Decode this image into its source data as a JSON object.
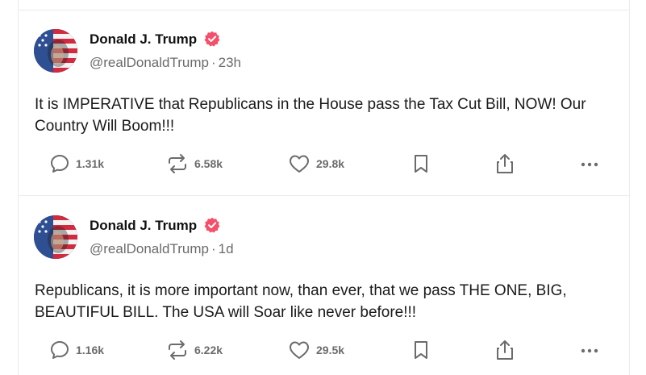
{
  "posts": [
    {
      "author": {
        "name": "Donald J. Trump",
        "handle": "@realDonaldTrump",
        "time": "23h",
        "verified_color": "#f5506b"
      },
      "text": "It is IMPERATIVE that Republicans in the House pass the Tax Cut Bill, NOW! Our Country Will Boom!!!",
      "stats": {
        "replies": "1.31k",
        "retruths": "6.58k",
        "likes": "29.8k"
      }
    },
    {
      "author": {
        "name": "Donald J. Trump",
        "handle": "@realDonaldTrump",
        "time": "1d",
        "verified_color": "#f5506b"
      },
      "text": "Republicans, it is more important now, than ever, that we pass THE ONE, BIG, BEAUTIFUL BILL. The USA will Soar like never before!!!",
      "stats": {
        "replies": "1.16k",
        "retruths": "6.22k",
        "likes": "29.5k"
      }
    }
  ],
  "ui": {
    "separator": "·"
  },
  "icons": {
    "reply": "speech-bubble-icon",
    "retruth": "repost-arrows-icon",
    "like": "heart-icon",
    "save": "bookmark-icon",
    "share": "share-upload-icon",
    "more": "ellipsis-icon"
  }
}
